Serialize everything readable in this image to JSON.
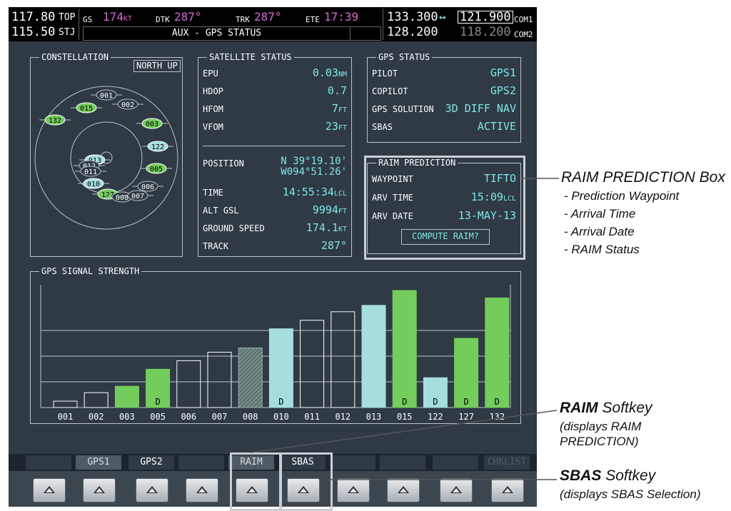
{
  "topbar": {
    "nav1_freq": "117.80",
    "nav1_id": "TOP",
    "nav2_freq": "115.50",
    "nav2_id": "STJ",
    "gs_label": "GS",
    "gs_value": "174",
    "gs_unit": "KT",
    "dtk_label": "DTK",
    "dtk_value": "287°",
    "trk_label": "TRK",
    "trk_value": "287°",
    "ete_label": "ETE",
    "ete_value": "17:39",
    "page_title": "AUX - GPS STATUS",
    "com1_active": "133.300",
    "com_swap": "↔",
    "com1_standby": "121.900",
    "com1_label": "COM1",
    "com2_active": "128.200",
    "com2_standby": "118.200",
    "com2_label": "COM2"
  },
  "constellation": {
    "title": "CONSTELLATION",
    "orientation": "NORTH UP",
    "sats": [
      {
        "id": "001",
        "color": "dark"
      },
      {
        "id": "002",
        "color": "dark"
      },
      {
        "id": "015",
        "color": "green"
      },
      {
        "id": "132",
        "color": "green"
      },
      {
        "id": "003",
        "color": "green"
      },
      {
        "id": "122",
        "color": "cyan"
      },
      {
        "id": "013",
        "color": "cyan"
      },
      {
        "id": "012",
        "color": "dark"
      },
      {
        "id": "011",
        "color": "dark"
      },
      {
        "id": "005",
        "color": "green"
      },
      {
        "id": "010",
        "color": "cyan"
      },
      {
        "id": "006",
        "color": "dark"
      },
      {
        "id": "127",
        "color": "green"
      },
      {
        "id": "008",
        "color": "dark"
      },
      {
        "id": "007",
        "color": "dark"
      }
    ]
  },
  "satellite_status": {
    "title": "SATELLITE STATUS",
    "epu_label": "EPU",
    "epu_value": "0.03",
    "epu_unit": "NM",
    "hdop_label": "HDOP",
    "hdop_value": "0.7",
    "hfom_label": "HFOM",
    "hfom_value": "7",
    "hfom_unit": "FT",
    "vfom_label": "VFOM",
    "vfom_value": "23",
    "vfom_unit": "FT",
    "position_label": "POSITION",
    "position_lat": "N 39°19.10'",
    "position_lon": "W094°51.26'",
    "time_label": "TIME",
    "time_value": "14:55:34",
    "time_unit": "LCL",
    "alt_label": "ALT GSL",
    "alt_value": "9994",
    "alt_unit": "FT",
    "gs_label": "GROUND SPEED",
    "gs_value": "174.1",
    "gs_unit": "KT",
    "track_label": "TRACK",
    "track_value": "287°"
  },
  "gps_status": {
    "title": "GPS STATUS",
    "pilot_label": "PILOT",
    "pilot_value": "GPS1",
    "copilot_label": "COPILOT",
    "copilot_value": "GPS2",
    "solution_label": "GPS SOLUTION",
    "solution_value": "3D DIFF NAV",
    "sbas_label": "SBAS",
    "sbas_value": "ACTIVE"
  },
  "raim": {
    "title": "RAIM PREDICTION",
    "waypoint_label": "WAYPOINT",
    "waypoint_value": "TIFTO",
    "arv_time_label": "ARV TIME",
    "arv_time_value": "15:09",
    "arv_time_unit": "LCL",
    "arv_date_label": "ARV DATE",
    "arv_date_value": "13-MAY-13",
    "compute_button": "COMPUTE RAIM?"
  },
  "signal_strength": {
    "title": "GPS SIGNAL STRENGTH"
  },
  "chart_data": {
    "type": "bar",
    "categories": [
      "001",
      "002",
      "003",
      "005",
      "006",
      "007",
      "008",
      "010",
      "011",
      "012",
      "013",
      "015",
      "122",
      "127",
      "132"
    ],
    "values": [
      0.06,
      0.14,
      0.2,
      0.36,
      0.44,
      0.52,
      0.56,
      0.74,
      0.82,
      0.9,
      0.96,
      1.1,
      0.28,
      0.65,
      1.03
    ],
    "colors": [
      "none",
      "none",
      "green",
      "green",
      "none",
      "none",
      "hatched",
      "cyan",
      "none",
      "none",
      "cyan",
      "green",
      "cyan",
      "green",
      "green"
    ],
    "flags": [
      "",
      "",
      "",
      "D",
      "",
      "",
      "",
      "D",
      "",
      "",
      "",
      "D",
      "D",
      "D",
      "D"
    ],
    "colors_hex": {
      "green": "#74cc5c",
      "cyan": "#a6dede",
      "hatched": "#6f8f8a"
    }
  },
  "softkeys": {
    "labels": [
      "",
      "",
      "GPS1",
      "GPS2",
      "",
      "RAIM",
      "SBAS",
      "",
      "",
      "",
      "",
      "CHKLIST"
    ]
  },
  "annotations": {
    "raim_box_title": "RAIM PREDICTION Box",
    "raim_box_items": [
      "- Prediction Waypoint",
      "- Arrival Time",
      "- Arrival Date",
      "- RAIM Status"
    ],
    "raim_softkey_bold": "RAIM",
    "raim_softkey_rest": " Softkey",
    "raim_softkey_desc1": "(displays RAIM",
    "raim_softkey_desc2": "PREDICTION)",
    "sbas_softkey_bold": "SBAS",
    "sbas_softkey_rest": " Softkey",
    "sbas_softkey_desc": "(displays SBAS Selection)"
  }
}
